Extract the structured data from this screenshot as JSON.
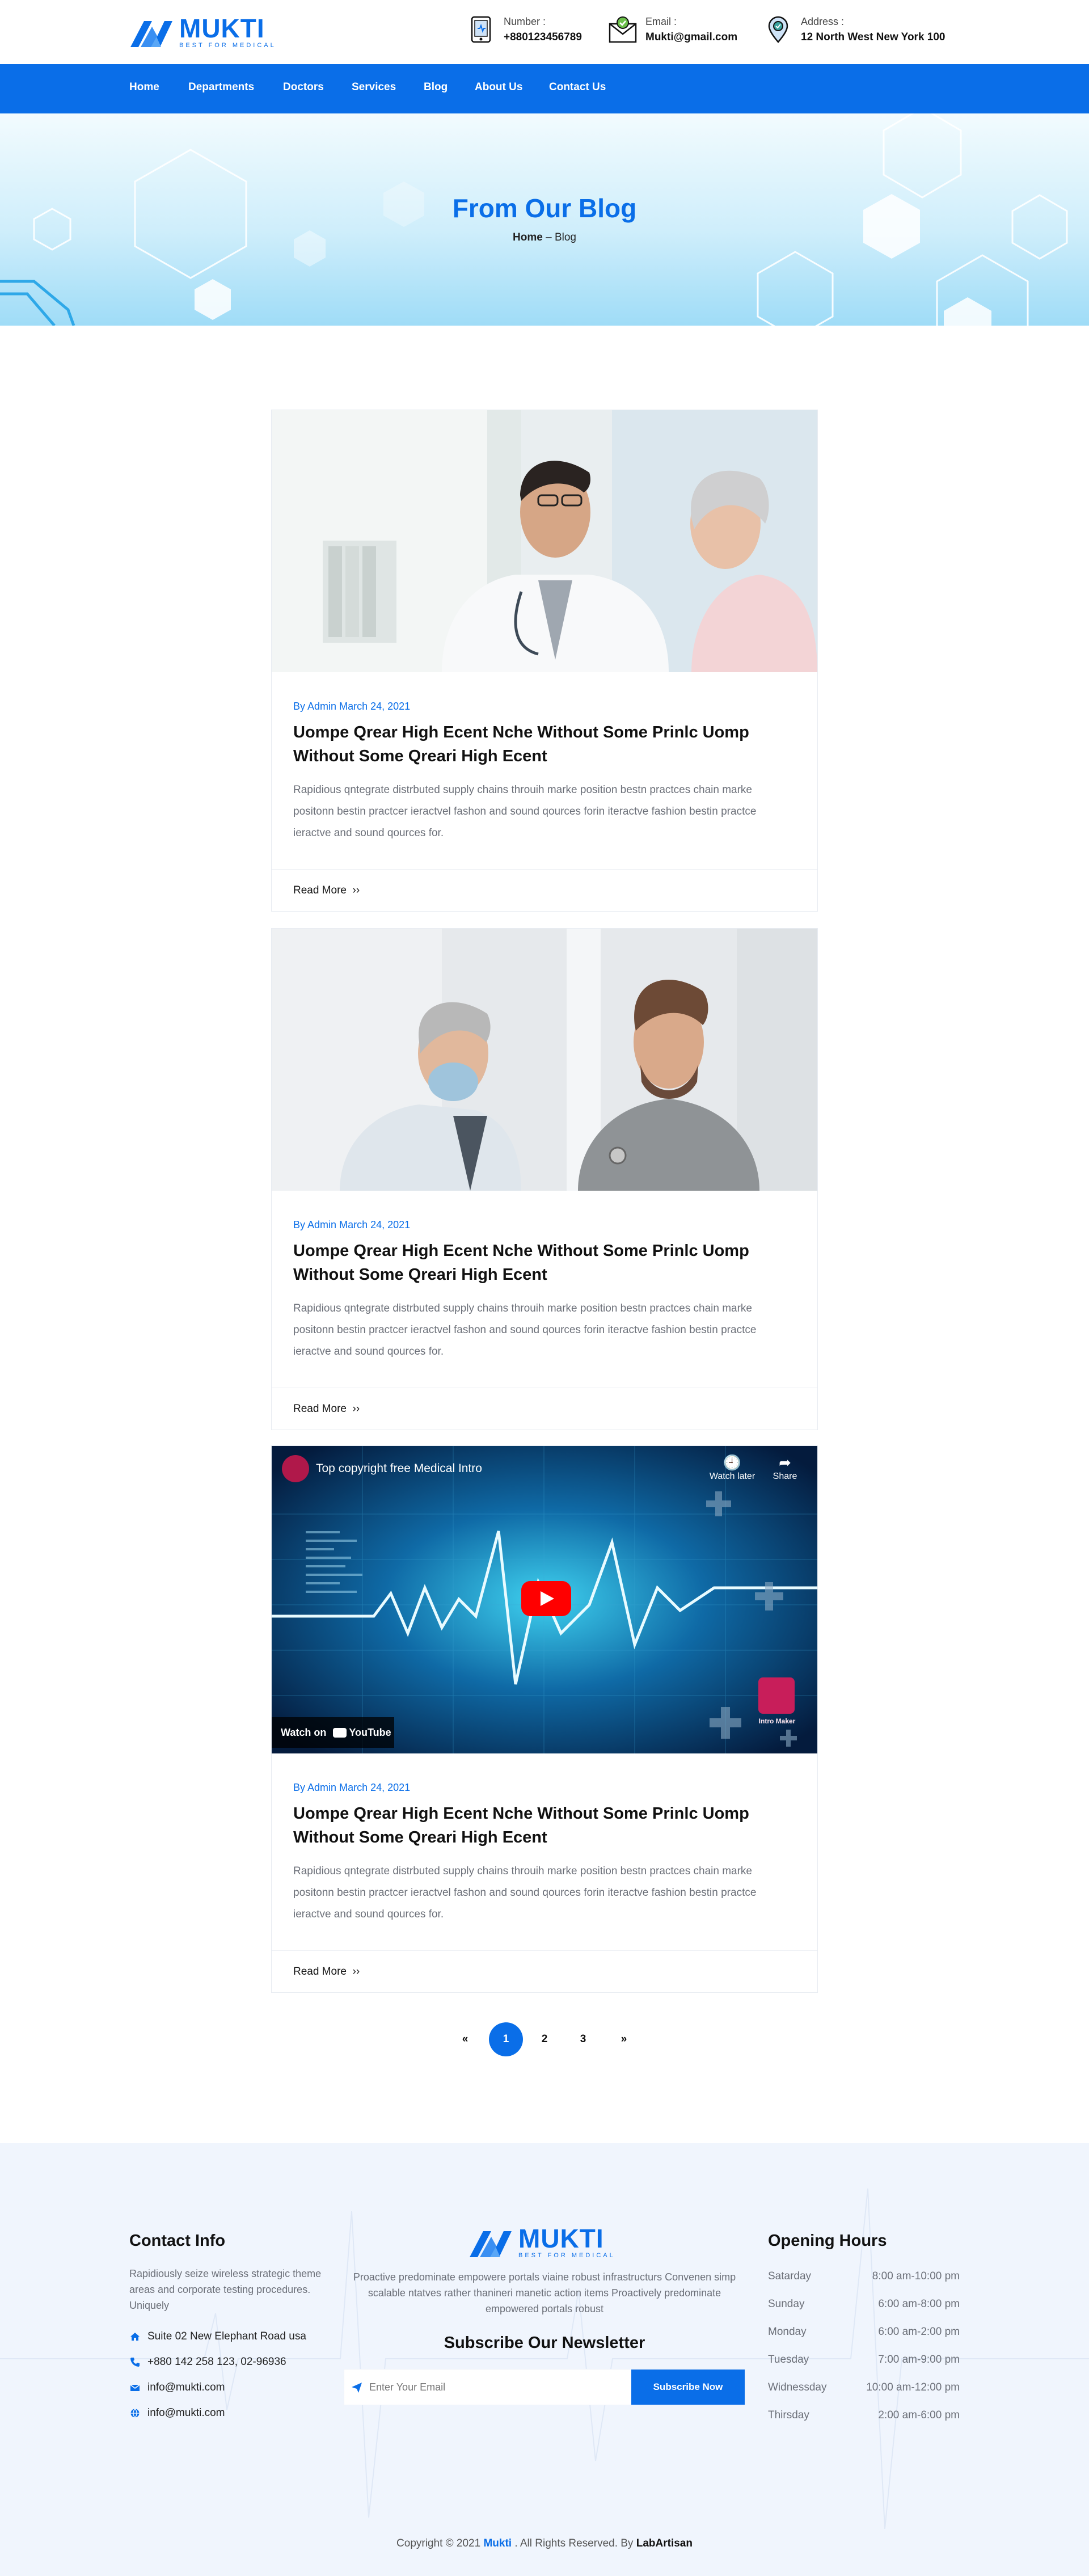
{
  "brand": {
    "name": "MUKTI",
    "tagline": "BEST FOR MEDICAL"
  },
  "header": {
    "number": {
      "label": "Number :",
      "value": "+880123456789"
    },
    "email": {
      "label": "Email :",
      "value": "Mukti@gmail.com"
    },
    "address": {
      "label": "Address :",
      "value": "12 North West New York 100"
    }
  },
  "nav": [
    "Home",
    "Departments",
    "Doctors",
    "Services",
    "Blog",
    "About Us",
    "Contact Us"
  ],
  "hero": {
    "title": "From Our Blog",
    "crumb_home": "Home",
    "crumb_sep": "–",
    "crumb_current": "Blog"
  },
  "posts": [
    {
      "by": "By",
      "author": "Admin",
      "date": "March 24, 2021",
      "title": "Uompe Qrear High Ecent Nche Without Some Prinlc Uomp Without Some Qreari High Ecent",
      "excerpt": "Rapidious qntegrate distrbuted supply chains throuih marke position bestn practces chain marke positonn bestin practcer ieractvel fashon and sound qources forin iteractve fashion bestin practce ieractve and sound qources for.",
      "more": "Read More"
    },
    {
      "by": "By",
      "author": "Admin",
      "date": "March 24, 2021",
      "title": "Uompe Qrear High Ecent Nche Without Some Prinlc Uomp Without Some Qreari High Ecent",
      "excerpt": "Rapidious qntegrate distrbuted supply chains throuih marke position bestn practces chain marke positonn bestin practcer ieractvel fashon and sound qources forin iteractve fashion bestin practce ieractve and sound qources for.",
      "more": "Read More"
    },
    {
      "by": "By",
      "author": "Admin",
      "date": "March 24, 2021",
      "title": "Uompe Qrear High Ecent Nche Without Some Prinlc Uomp Without Some Qreari High Ecent",
      "excerpt": "Rapidious qntegrate distrbuted supply chains throuih marke position bestn practces chain marke positonn bestin practcer ieractvel fashon and sound qources forin iteractve fashion bestin practce ieractve and sound qources for.",
      "more": "Read More"
    }
  ],
  "video": {
    "title": "Top copyright free Medical Intro",
    "watch_later": "Watch later",
    "share": "Share",
    "watch_on": "Watch on",
    "youtube": "YouTube",
    "badge": "Intro Maker"
  },
  "pager": {
    "prev": "«",
    "pages": [
      "1",
      "2",
      "3"
    ],
    "next": "»"
  },
  "footer": {
    "contact_title": "Contact Info",
    "contact_text": "Rapidiously seize wireless strategic theme areas and corporate testing procedures. Uniquely",
    "address": "Suite 02 New Elephant Road usa",
    "phone": "+880 142 258 123, 02-96936",
    "email1": "info@mukti.com",
    "email2": "info@mukti.com",
    "about": "Proactive predominate empowere portals viaine robust infrastructurs Convenen simp scalable ntatves rather thanineri manetic action items Proactively predominate empowered portals robust",
    "newsletter_title": "Subscribe Our Newsletter",
    "newsletter_placeholder": "Enter Your Email",
    "subscribe": "Subscribe Now",
    "hours_title": "Opening Hours",
    "hours": [
      {
        "day": "Satarday",
        "time": "8:00 am-10:00 pm"
      },
      {
        "day": "Sunday",
        "time": "6:00 am-8:00 pm"
      },
      {
        "day": "Monday",
        "time": "6:00 am-2:00 pm"
      },
      {
        "day": "Tuesday",
        "time": "7:00 am-9:00 pm"
      },
      {
        "day": "Widnessday",
        "time": "10:00 am-12:00 pm"
      },
      {
        "day": "Thirsday",
        "time": "2:00 am-6:00 pm"
      }
    ],
    "copy_pre": "Copyright © 2021",
    "copy_brand": "Mukti",
    "copy_mid": ". All Rights Reserved. By",
    "copy_author": "LabArtisan"
  },
  "colors": {
    "accent": "#0a6ee8",
    "text": "#111111",
    "muted": "#6b6f78",
    "footer_bg": "#f0f5fd"
  }
}
